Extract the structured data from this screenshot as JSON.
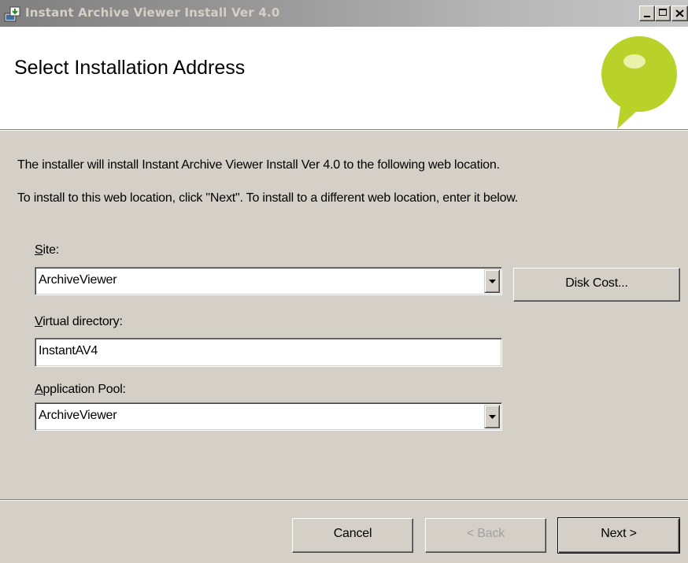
{
  "window": {
    "title": "Instant Archive Viewer Install Ver 4.0",
    "icon": "installer-icon"
  },
  "header": {
    "title": "Select Installation Address",
    "logo": "speech-bubble-logo",
    "logo_color": "#b8d22a"
  },
  "body": {
    "intro_line": "The installer will install Instant Archive Viewer Install Ver 4.0 to the following web location.",
    "instruction_line": "To install to this web location, click \"Next\". To install to a different web location, enter it below."
  },
  "site": {
    "label_mnemonic": "S",
    "label_rest": "ite:",
    "value": "ArchiveViewer"
  },
  "virtual_directory": {
    "label_mnemonic": "V",
    "label_rest": "irtual directory:",
    "value": "InstantAV4"
  },
  "app_pool": {
    "label_mnemonic": "A",
    "label_rest": "pplication Pool:",
    "value": "ArchiveViewer"
  },
  "buttons": {
    "disk_cost": "Disk Cost...",
    "cancel": "Cancel",
    "back": "< Back",
    "next": "Next >"
  }
}
